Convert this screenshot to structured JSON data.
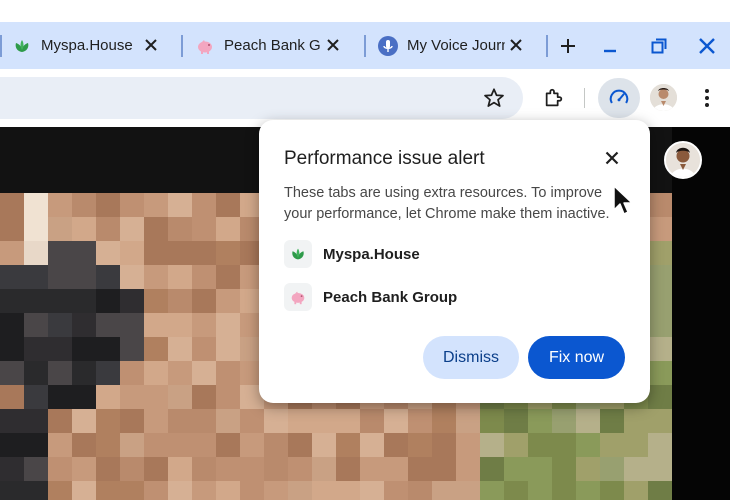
{
  "tabs": [
    {
      "title": "Myspa.House",
      "favicon": "leaf-icon"
    },
    {
      "title": "Peach Bank Gr",
      "favicon": "piggy-bank-icon"
    },
    {
      "title": "My Voice Journ",
      "favicon": "microphone-icon"
    }
  ],
  "window_controls": {
    "new_tab": "plus-icon",
    "minimize": "minimize-icon",
    "restore": "restore-icon",
    "close": "close-icon"
  },
  "toolbar": {
    "bookmark": "star-icon",
    "extensions": "puzzle-icon",
    "performance": "speedometer-icon",
    "menu": "kebab-menu-icon"
  },
  "popup": {
    "title": "Performance issue alert",
    "description": "These tabs are using extra resources. To improve your performance, let Chrome make them inactive.",
    "items": [
      {
        "label": "Myspa.House",
        "icon": "leaf-icon"
      },
      {
        "label": "Peach Bank Group",
        "icon": "piggy-bank-icon"
      }
    ],
    "dismiss_label": "Dismiss",
    "fix_label": "Fix now"
  },
  "colors": {
    "tabstrip": "#d3e3fd",
    "accent": "#0b57d0",
    "dismiss_bg": "#d3e3fd",
    "leaf": "#2e9b4a",
    "piggy": "#f3a6c0",
    "mic": "#4a6fc4"
  }
}
